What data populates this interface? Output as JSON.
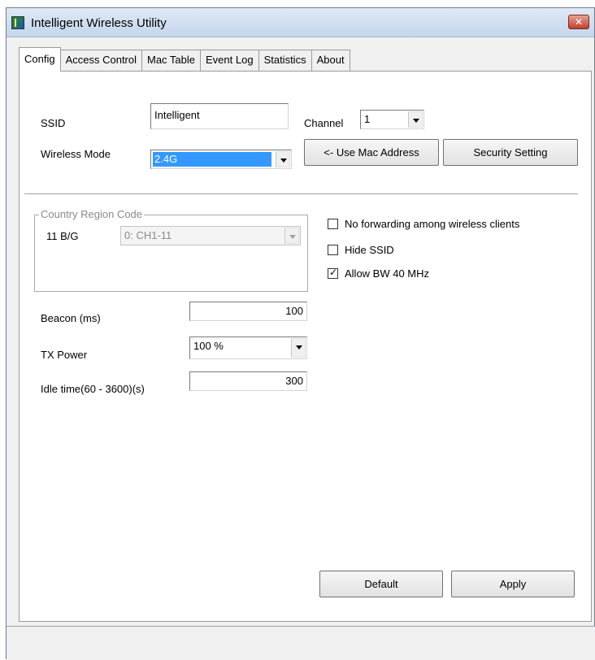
{
  "window": {
    "title": "Intelligent Wireless Utility"
  },
  "tabs": [
    {
      "label": "Config",
      "active": true
    },
    {
      "label": "Access Control",
      "active": false
    },
    {
      "label": "Mac Table",
      "active": false
    },
    {
      "label": "Event Log",
      "active": false
    },
    {
      "label": "Statistics",
      "active": false
    },
    {
      "label": "About",
      "active": false
    }
  ],
  "config": {
    "ssid_label": "SSID",
    "ssid_value": "Intelligent",
    "channel_label": "Channel",
    "channel_value": "1",
    "wireless_mode_label": "Wireless Mode",
    "wireless_mode_value": "2.4G",
    "use_mac_button": "<- Use Mac Address",
    "security_button": "Security Setting",
    "country_group_title": "Country Region Code",
    "country_band_label": "11 B/G",
    "country_value": "0: CH1-11",
    "checkboxes": [
      {
        "label": "No forwarding among wireless clients",
        "checked": false
      },
      {
        "label": "Hide SSID",
        "checked": false
      },
      {
        "label": "Allow BW 40 MHz",
        "checked": true
      }
    ],
    "beacon_label": "Beacon (ms)",
    "beacon_value": "100",
    "tx_power_label": "TX Power",
    "tx_power_value": "100 %",
    "idle_label": "Idle time(60 - 3600)(s)",
    "idle_value": "300",
    "default_button": "Default",
    "apply_button": "Apply"
  },
  "colors": {
    "selection": "#3399ff",
    "close_button": "#c04030"
  }
}
